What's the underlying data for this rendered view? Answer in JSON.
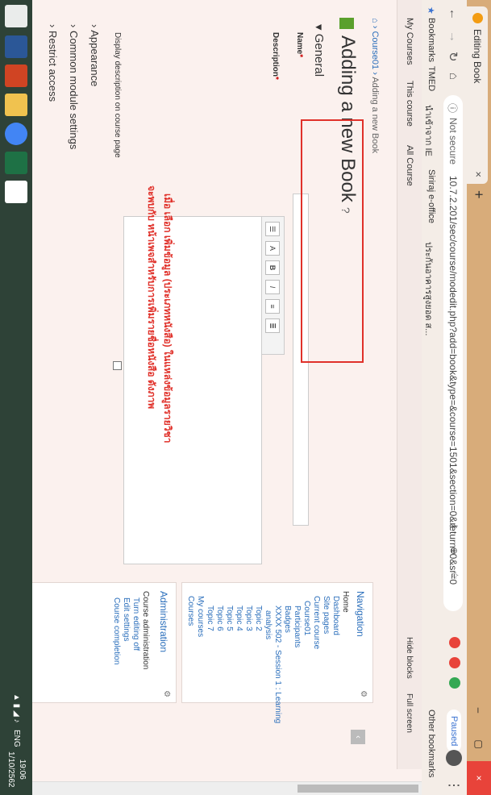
{
  "browser": {
    "tab_title": "Editing Book",
    "tab_close": "×",
    "new_tab": "+",
    "window_controls": [
      "–",
      "▢",
      "×"
    ],
    "not_secure": "Not secure",
    "url": "10.7.2.201/sec/course/modedit.php?add=book&type=&course=1501&section=0&return=0&sr=0",
    "profile_status": "Paused",
    "accent": "#d8ac7a"
  },
  "bookmarks": {
    "label": "Bookmarks",
    "items": [
      "TMED",
      "นำเข้าจาก IE",
      "Siriraj e-office",
      "ประกันอาคารสูงยอด ส..."
    ],
    "other": "Other bookmarks"
  },
  "topnav": {
    "items": [
      "My Courses",
      "This course",
      "All Course"
    ],
    "hide_blocks": "Hide blocks",
    "full_screen": "Full screen"
  },
  "breadcrumb": {
    "home_icon": "home-icon",
    "course": "Course01",
    "current": "Adding a new Book"
  },
  "page": {
    "title": "Adding a new Book",
    "section_general": "General",
    "name_label": "Name",
    "description_label": "Description",
    "display_desc_label": "Display description on course page",
    "appearance": "Appearance",
    "common_module": "Common module settings",
    "restrict_access": "Restrict access"
  },
  "annotation": {
    "line1": "เมื่อ เลือก เพิ่มข้อมูล (ประเภทหนังสือ) ในแหล่งข้อมูลรายวิชา",
    "line2": "จะพบกับ หน้าเพจสำหรับการเพิ่มรายชื่อหนังสือ ดังภาพ",
    "color": "#e0312a"
  },
  "navigation_block": {
    "title": "Navigation",
    "items": [
      "Home",
      "Dashboard",
      "Site pages",
      "Current course",
      "Course01",
      "Participants",
      "Badges",
      "XXXX 502 - Session 1 : Learning",
      "analysis",
      "Topic 2",
      "Topic 3",
      "Topic 4",
      "Topic 5",
      "Topic 6",
      "Topic 7",
      "My courses",
      "Courses"
    ]
  },
  "administration_block": {
    "title": "Administration",
    "items": [
      "Course administration",
      "Turn editing off",
      "Edit settings",
      "Course completion"
    ]
  },
  "taskbar": {
    "lang": "ENG",
    "time": "19:06",
    "date": "1/10/2562"
  }
}
